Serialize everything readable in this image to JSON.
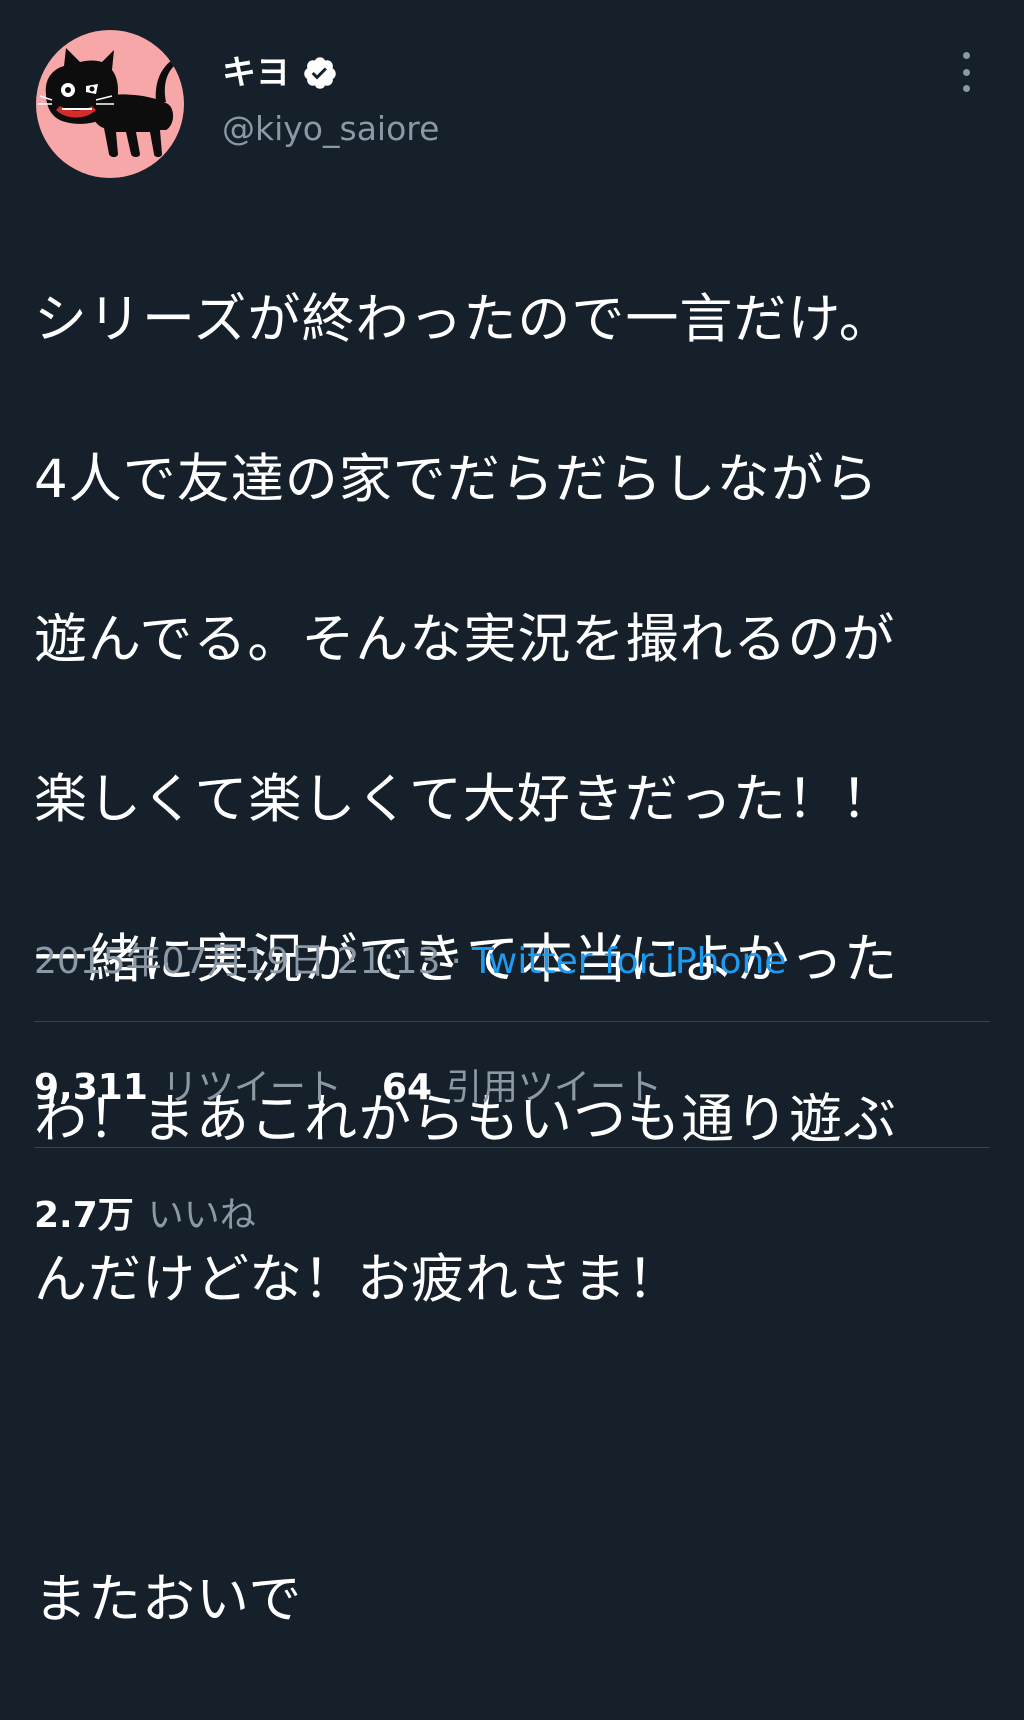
{
  "user": {
    "display_name": "キヨ",
    "handle": "@kiyo_saiore",
    "verified_icon": "verified-badge-icon",
    "avatar_bg": "#f7a7a7"
  },
  "tweet": {
    "lines": [
      "シリーズが終わったので一言だけ。",
      "4人で友達の家でだらだらしながら",
      "遊んでる。そんな実況を撮れるのが",
      "楽しくて楽しくて大好きだった！！",
      "一緒に実況ができて本当によかった",
      "わ！まあこれからもいつも通り遊ぶ",
      "んだけどな！お疲れさま！",
      "",
      "またおいで"
    ]
  },
  "meta": {
    "timestamp": "2015年07月19日 21:13",
    "separator": "·",
    "source": "Twitter for iPhone"
  },
  "stats": {
    "retweets": {
      "count": "9,311",
      "label": "リツイート"
    },
    "quotes": {
      "count": "64",
      "label": "引用ツイート"
    },
    "likes": {
      "count": "2.7万",
      "label": "いいね"
    }
  },
  "colors": {
    "background": "#15202b",
    "text": "#ffffff",
    "secondary": "#8b98a5",
    "link": "#1d9bf0",
    "divider": "#38444d"
  }
}
